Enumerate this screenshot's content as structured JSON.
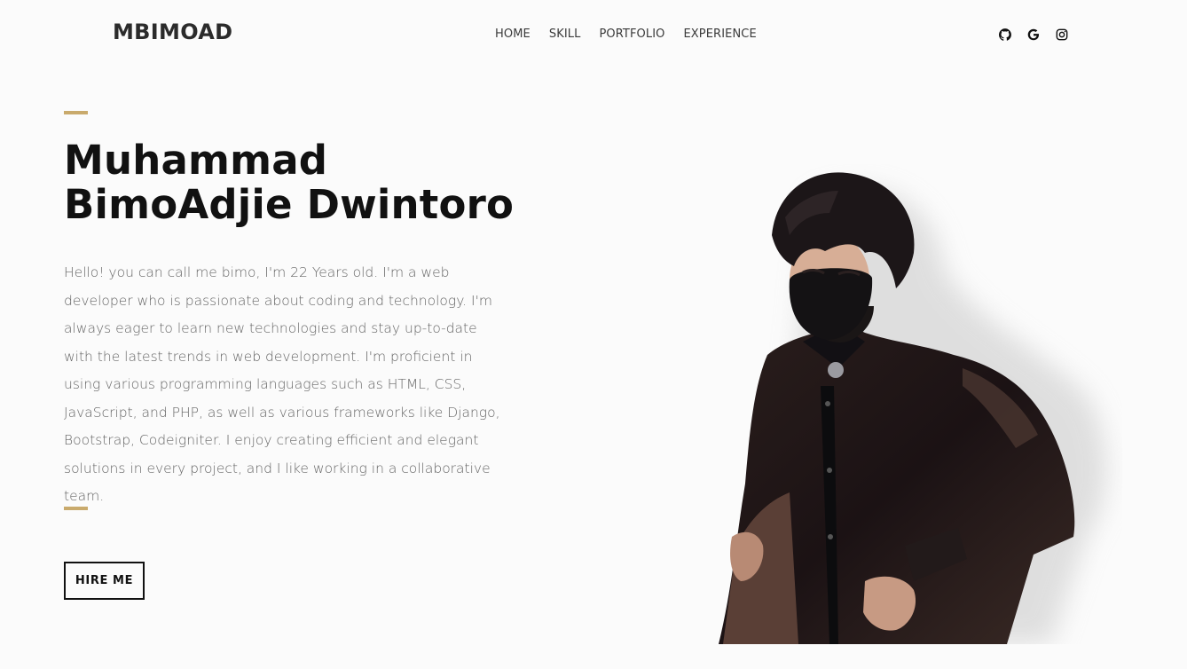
{
  "header": {
    "brand": "MBIMOAD",
    "nav": [
      "HOME",
      "SKILL",
      "PORTFOLIO",
      "EXPERIENCE"
    ],
    "social_icons": [
      "github-icon",
      "google-icon",
      "instagram-icon"
    ]
  },
  "hero": {
    "name_line1": "Muhammad",
    "name_line2": "BimoAdjie Dwintoro",
    "bio": "Hello! you can call me bimo, I'm 22 Years old. I'm a web developer who is passionate about coding and technology. I'm always eager to learn new technologies and stay up-to-date with the latest trends in web development. I'm proficient in using various programming languages such as HTML, CSS, JavaScript, and PHP, as well as various frameworks like Django, Bootstrap, Codeigniter. I enjoy creating efficient and elegant solutions in every project, and I like working in a collaborative team.",
    "cta_label": "HIRE ME"
  },
  "colors": {
    "accent": "#c9aa6c",
    "text": "#111111",
    "muted": "#666666",
    "background": "#fbfbfb"
  }
}
